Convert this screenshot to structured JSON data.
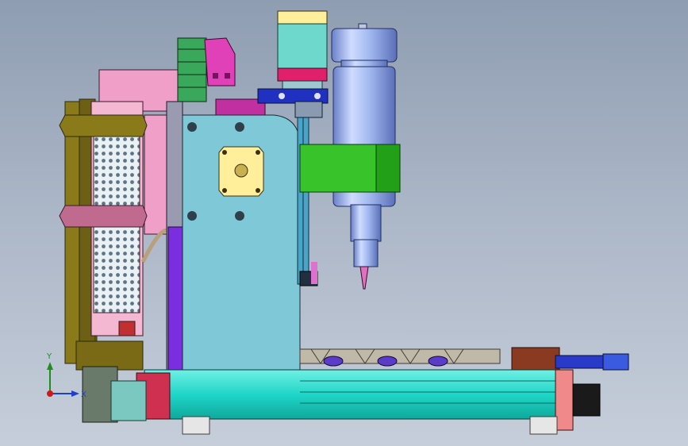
{
  "viewport": {
    "background_top": "#8f9db2",
    "background_bottom": "#c6ceda"
  },
  "model": {
    "parts": [
      {
        "name": "stepper-motor-top",
        "color": "#6fd8cc"
      },
      {
        "name": "motor-flange",
        "color": "#ffef9a"
      },
      {
        "name": "spindle-body",
        "color": "#9fb6ee"
      },
      {
        "name": "spindle-clamp",
        "color": "#39c32b"
      },
      {
        "name": "gantry-plate",
        "color": "#7ec8d8"
      },
      {
        "name": "power-supply",
        "color": "#f0a0c8"
      },
      {
        "name": "cable-carrier",
        "color": "#3aa85a"
      },
      {
        "name": "base-rail",
        "color": "#1fd6c8"
      },
      {
        "name": "lead-screw",
        "color": "#4aa3c8"
      },
      {
        "name": "z-rail",
        "color": "#7a2ee0"
      },
      {
        "name": "side-bracket",
        "color": "#8a7a1a"
      },
      {
        "name": "spoilboard-clamps",
        "color": "#5a3cc8"
      }
    ]
  },
  "triad": {
    "y_label": "Y",
    "x_label": "X",
    "y_color": "#1e8f1e",
    "x_color": "#1f3fd0",
    "z_color": "#d01818"
  }
}
